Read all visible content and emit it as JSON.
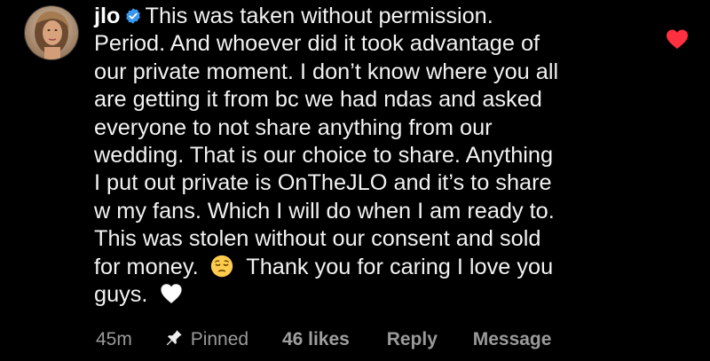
{
  "comment": {
    "username": "jlo",
    "verified": true,
    "lines": [
      "This was taken without permission.",
      "Period. And whoever did it took advantage of",
      "our private moment. I don’t know where you all",
      "are getting it from bc we had ndas and asked",
      "everyone to not share anything from our",
      "wedding. That is our choice to share. Anything",
      "I put out private is OnTheJLO and it’s to share",
      "w my fans. Which I will do when I am ready to.",
      "This was stolen without our consent and sold"
    ],
    "line10_before_emoji": "for money.",
    "emoji_1": "pensive-face",
    "line10_after_emoji": "Thank you for caring I love you",
    "line11": "guys.",
    "emoji_2": "white-heart"
  },
  "footer": {
    "time": "45m",
    "pinned_label": "Pinned",
    "likes": "46 likes",
    "reply_label": "Reply",
    "message_label": "Message"
  },
  "like": {
    "state": "liked",
    "color": "#ff3040"
  },
  "colors": {
    "background": "#000000",
    "text": "#f2f2f2",
    "muted": "#9a9a9a",
    "verified": "#3897f0",
    "like": "#ff3040"
  }
}
